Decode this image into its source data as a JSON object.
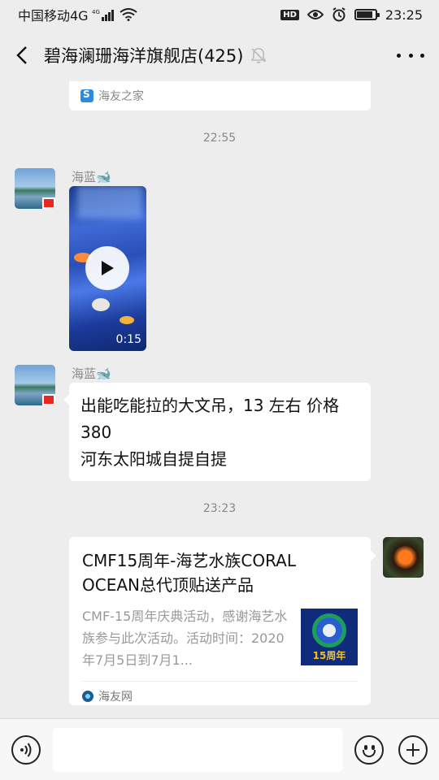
{
  "status_bar": {
    "carrier": "中国移动4G",
    "network_badge": "4G",
    "hd_label": "HD",
    "time": "23:25",
    "battery_level": 0.85
  },
  "header": {
    "title": "碧海澜珊海洋旗舰店(425)",
    "icons": [
      "back-icon",
      "mute-icon",
      "more-icon"
    ]
  },
  "chat": {
    "prev_card_source": "海友之家",
    "timestamps": [
      "22:55",
      "23:23"
    ],
    "messages": [
      {
        "sender": "海蓝🐋",
        "type": "video",
        "duration": "0:15"
      },
      {
        "sender": "海蓝🐋",
        "type": "text",
        "text": "出能吃能拉的大文吊，13 左右   价格 380\n河东太阳城自提自提"
      },
      {
        "sender": "self",
        "type": "link_card",
        "title": "CMF15周年-海艺水族CORAL OCEAN总代顶贴送产品",
        "description": "CMF-15周年庆典活动，感谢海艺水族参与此次活动。活动时间：2020年7月5日到7月1...",
        "thumb_text": "15周年",
        "source": "海友网"
      }
    ]
  },
  "input_bar": {
    "placeholder": "",
    "icons": [
      "voice-icon",
      "emoji-icon",
      "plus-icon"
    ]
  }
}
